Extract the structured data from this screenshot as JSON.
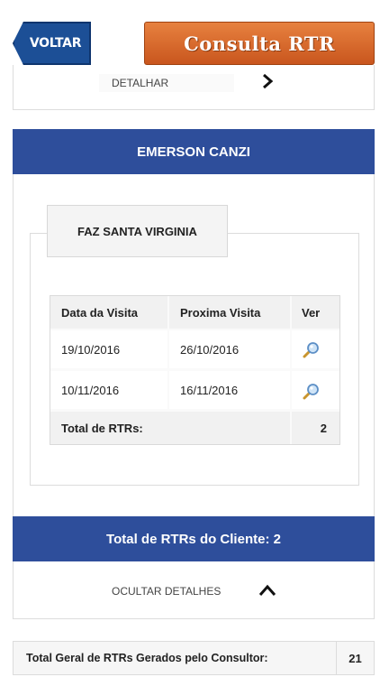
{
  "header": {
    "back_label": "VOLTAR",
    "title": "Consulta RTR"
  },
  "top_panel": {
    "detail_label": "DETALHAR"
  },
  "consultant": {
    "name": "EMERSON CANZI"
  },
  "farm": {
    "name": "FAZ SANTA VIRGINIA",
    "table": {
      "columns": [
        "Data da Visita",
        "Proxima Visita",
        "Ver"
      ],
      "rows": [
        {
          "visit_date": "19/10/2016",
          "next_visit": "26/10/2016",
          "view_icon": "magnifier-icon"
        },
        {
          "visit_date": "10/11/2016",
          "next_visit": "16/11/2016",
          "view_icon": "magnifier-icon"
        }
      ],
      "total_label": "Total de RTRs:",
      "total_value": "2"
    }
  },
  "client_total": "Total de RTRs do Cliente: 2",
  "hide_panel": {
    "hide_label": "OCULTAR DETALHES"
  },
  "grand_total": {
    "label": "Total Geral de RTRs Gerados pelo Consultor:",
    "value": "21"
  },
  "colors": {
    "primary_blue": "#2e4e9b",
    "back_button_blue": "#1c4f96",
    "title_orange": "#d86a2c"
  }
}
